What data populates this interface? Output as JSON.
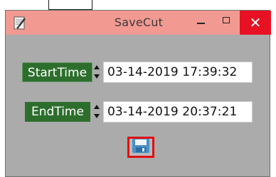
{
  "window": {
    "title": "SaveCut",
    "close_glyph": "✕",
    "icons": {
      "app": "pen-paper-icon",
      "minimize": "minimize-icon",
      "maximize": "maximize-icon",
      "close": "close-icon",
      "save": "floppy-disk-icon"
    }
  },
  "fields": {
    "start": {
      "label": "StartTime",
      "value": "03-14-2019 17:39:32"
    },
    "end": {
      "label": "EndTime",
      "value": "03-14-2019 20:37:21"
    }
  },
  "colors": {
    "titlebar": "#f29a92",
    "close_button": "#e81123",
    "window_bg": "#ababab",
    "label_bg": "#2d6e2d",
    "save_highlight": "#e01010"
  }
}
